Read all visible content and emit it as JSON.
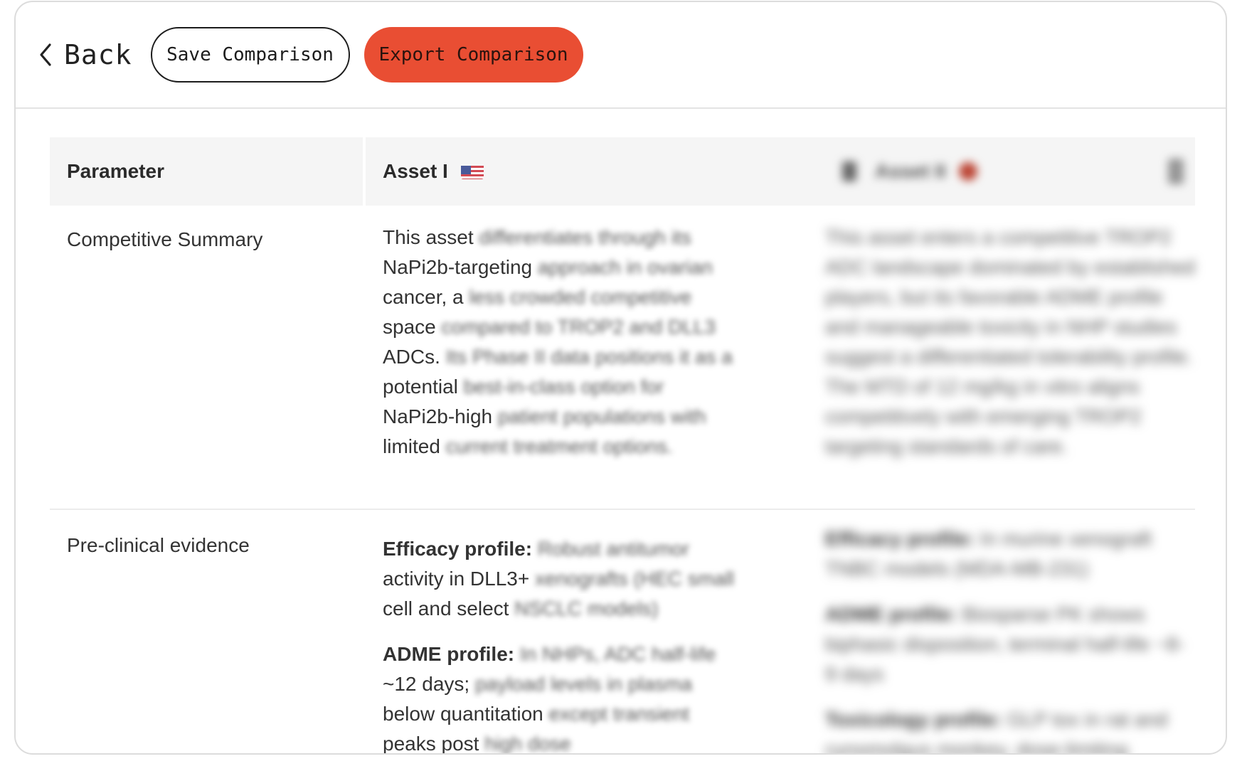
{
  "toolbar": {
    "back_label": "Back",
    "save_label": "Save Comparison",
    "export_label": "Export Comparison"
  },
  "table": {
    "headers": {
      "parameter": "Parameter",
      "asset1": "Asset I",
      "asset2": "Asset II"
    },
    "rows": [
      {
        "parameter": "Competitive Summary",
        "asset1_lines": [
          [
            "This asset ",
            "differentiates through its"
          ],
          [
            "NaPi2b-targeting ",
            "approach in ovarian"
          ],
          [
            "cancer, a ",
            "less crowded competitive"
          ],
          [
            "space ",
            "compared to TROP2 and DLL3"
          ],
          [
            "ADCs. ",
            "Its Phase II data positions it as a"
          ],
          [
            "potential ",
            "best-in-class option for"
          ],
          [
            "NaPi2b-high ",
            "patient populations with"
          ],
          [
            "limited ",
            "current treatment options."
          ]
        ],
        "asset2_text": "This asset enters a competitive TROP2 ADC landscape dominated by established players, but its favorable ADME profile and manageable toxicity in NHP studies suggest a differentiated tolerability profile. The MTD of 12 mg/kg in vitro aligns competitively with emerging TROP2 targeting standards of care."
      },
      {
        "parameter": "Pre-clinical evidence",
        "asset1_blocks": [
          {
            "lines": [
              [
                "Efficacy profile:",
                " Robust antitumor"
              ],
              [
                "activity in DLL3+ ",
                "xenografts (HEC small"
              ],
              [
                "cell and select ",
                "NSCLC models)"
              ]
            ]
          },
          {
            "lines": [
              [
                "ADME profile:",
                " In NHPs, ADC half-life"
              ],
              [
                "~12 days; ",
                "payload levels in plasma"
              ],
              [
                "below quantitation ",
                "except transient"
              ],
              [
                "peaks post ",
                "high dose"
              ]
            ]
          }
        ],
        "asset2_blocks": [
          {
            "label": "Efficacy profile:",
            "text": " In murine xenograft TNBC models (MDA-MB-231)"
          },
          {
            "label": "ADME profile:",
            "text": " Biosparse PK shows biphasic disposition, terminal half-life ~8-9 days"
          },
          {
            "label": "Toxicology profile:",
            "text": " GLP tox in rat and cynomolgus monkey, dose-limiting"
          }
        ]
      }
    ]
  }
}
